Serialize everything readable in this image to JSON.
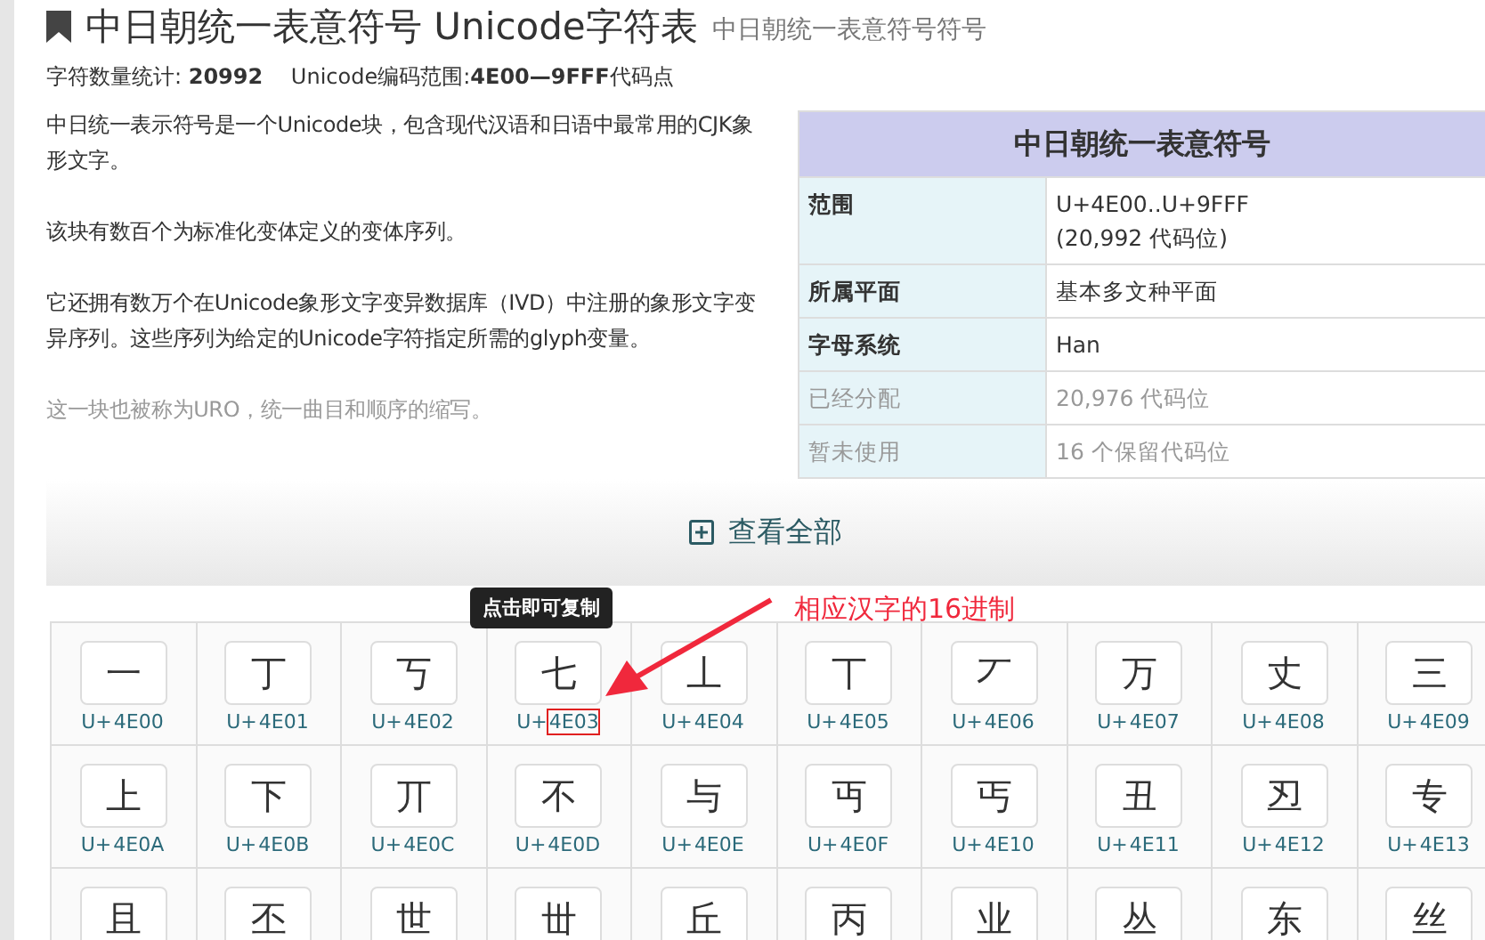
{
  "title": "中日朝统一表意符号 Unicode字符表",
  "subtitle": "中日朝统一表意符号符号",
  "stats": "字符数量统计: **20992**　 Unicode编码范围:**4E00—9FFF**代码点",
  "paragraphs": [
    {
      "text": "中日统一表示符号是一个Unicode块，包含现代汉语和日语中最常用的CJK象形文字。",
      "muted": false
    },
    {
      "text": "该块有数百个为标准化变体定义的变体序列。",
      "muted": false
    },
    {
      "text": "它还拥有数万个在Unicode象形文字变异数据库（IVD）中注册的象形文字变异序列。这些序列为给定的Unicode字符指定所需的glyph变量。",
      "muted": false
    },
    {
      "text": "这一块也被称为URO，统一曲目和顺序的缩写。",
      "muted": true
    }
  ],
  "infobox": {
    "title": "中日朝统一表意符号",
    "rows": [
      {
        "label": "范围",
        "value": [
          "U+4E00..U+9FFF",
          "(20,992 代码位)"
        ],
        "muted": false
      },
      {
        "label": "所属平面",
        "value": [
          "基本多文种平面"
        ],
        "muted": false
      },
      {
        "label": "字母系统",
        "value": [
          "Han"
        ],
        "muted": false
      },
      {
        "label": "已经分配",
        "value": [
          "20,976 代码位"
        ],
        "muted": true
      },
      {
        "label": "暂未使用",
        "value": [
          "16 个保留代码位"
        ],
        "muted": true
      }
    ]
  },
  "view_all": "查看全部",
  "tooltip": "点击即可复制",
  "annotation": "相应汉字的16进制",
  "characters": [
    {
      "char": "一",
      "prefix": "U+",
      "hex": "4E00",
      "highlighted": false
    },
    {
      "char": "丁",
      "prefix": "U+",
      "hex": "4E01",
      "highlighted": false
    },
    {
      "char": "丂",
      "prefix": "U+",
      "hex": "4E02",
      "highlighted": false
    },
    {
      "char": "七",
      "prefix": "U+",
      "hex": "4E03",
      "highlighted": true
    },
    {
      "char": "丄",
      "prefix": "U+",
      "hex": "4E04",
      "highlighted": false
    },
    {
      "char": "丅",
      "prefix": "U+",
      "hex": "4E05",
      "highlighted": false
    },
    {
      "char": "丆",
      "prefix": "U+",
      "hex": "4E06",
      "highlighted": false
    },
    {
      "char": "万",
      "prefix": "U+",
      "hex": "4E07",
      "highlighted": false
    },
    {
      "char": "丈",
      "prefix": "U+",
      "hex": "4E08",
      "highlighted": false
    },
    {
      "char": "三",
      "prefix": "U+",
      "hex": "4E09",
      "highlighted": false
    },
    {
      "char": "上",
      "prefix": "U+",
      "hex": "4E0A",
      "highlighted": false
    },
    {
      "char": "下",
      "prefix": "U+",
      "hex": "4E0B",
      "highlighted": false
    },
    {
      "char": "丌",
      "prefix": "U+",
      "hex": "4E0C",
      "highlighted": false
    },
    {
      "char": "不",
      "prefix": "U+",
      "hex": "4E0D",
      "highlighted": false
    },
    {
      "char": "与",
      "prefix": "U+",
      "hex": "4E0E",
      "highlighted": false
    },
    {
      "char": "丏",
      "prefix": "U+",
      "hex": "4E0F",
      "highlighted": false
    },
    {
      "char": "丐",
      "prefix": "U+",
      "hex": "4E10",
      "highlighted": false
    },
    {
      "char": "丑",
      "prefix": "U+",
      "hex": "4E11",
      "highlighted": false
    },
    {
      "char": "丒",
      "prefix": "U+",
      "hex": "4E12",
      "highlighted": false
    },
    {
      "char": "专",
      "prefix": "U+",
      "hex": "4E13",
      "highlighted": false
    },
    {
      "char": "且"
    },
    {
      "char": "丕"
    },
    {
      "char": "世"
    },
    {
      "char": "丗"
    },
    {
      "char": "丘"
    },
    {
      "char": "丙"
    },
    {
      "char": "业"
    },
    {
      "char": "丛"
    },
    {
      "char": "东"
    },
    {
      "char": "丝"
    }
  ]
}
